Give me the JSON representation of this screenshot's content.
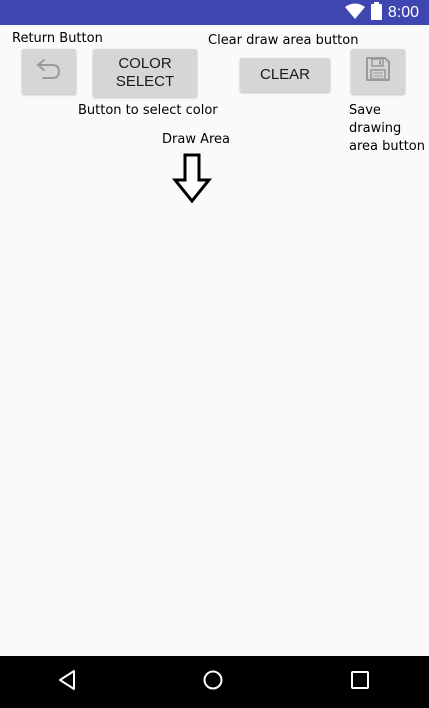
{
  "status_bar": {
    "time": "8:00",
    "background": "#3f46b0",
    "icons": [
      "wifi-icon",
      "battery-icon"
    ]
  },
  "annotations": {
    "return_button": "Return Button",
    "clear_draw_area_button": "Clear draw area button",
    "select_color_button": "Button to select color",
    "save_button_line1": "Save",
    "save_button_line2": "drawing",
    "save_button_line3": "area button",
    "draw_area": "Draw Area"
  },
  "toolbar": {
    "return_icon": "undo-icon",
    "color_select_line1": "COLOR",
    "color_select_line2": "SELECT",
    "clear_label": "CLEAR",
    "save_icon": "floppy-disk-icon",
    "button_color": "#d6d6d6"
  },
  "nav_bar": {
    "icons": [
      "back-icon",
      "home-icon",
      "recents-icon"
    ],
    "background": "#000000"
  }
}
